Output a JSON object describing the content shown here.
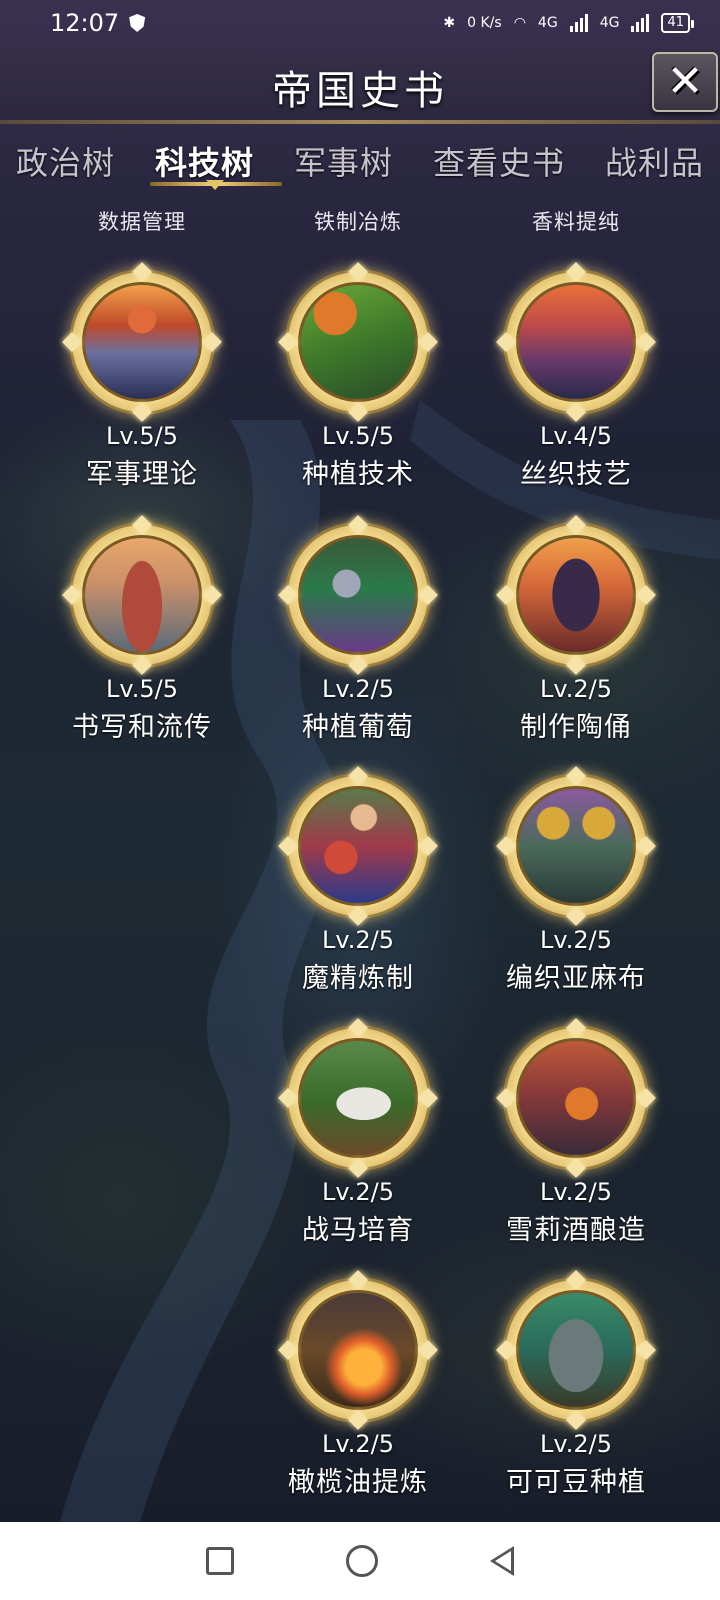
{
  "status_bar": {
    "time": "12:07",
    "net_speed": "0 K/s",
    "signal_1": "4G",
    "signal_2": "4G",
    "battery": "41"
  },
  "header": {
    "title": "帝国史书"
  },
  "tabs": [
    {
      "label": "政治树",
      "active": false
    },
    {
      "label": "科技树",
      "active": true
    },
    {
      "label": "军事树",
      "active": false
    },
    {
      "label": "查看史书",
      "active": false
    },
    {
      "label": "战利品",
      "active": false
    }
  ],
  "columns": [
    {
      "header": "数据管理"
    },
    {
      "header": "铁制冶炼"
    },
    {
      "header": "香料提纯"
    }
  ],
  "nodes": {
    "c0r0": {
      "level": "Lv.5/5",
      "name": "军事理论",
      "icon": "knight-banner-icon"
    },
    "c1r0": {
      "level": "Lv.5/5",
      "name": "种植技术",
      "icon": "farm-field-icon"
    },
    "c2r0": {
      "level": "Lv.4/5",
      "name": "丝织技艺",
      "icon": "silk-workshop-icon"
    },
    "c0r1": {
      "level": "Lv.5/5",
      "name": "书写和流传",
      "icon": "terracotta-warrior-icon"
    },
    "c1r1": {
      "level": "Lv.2/5",
      "name": "种植葡萄",
      "icon": "vineyard-icon"
    },
    "c2r1": {
      "level": "Lv.2/5",
      "name": "制作陶俑",
      "icon": "pottery-figure-icon"
    },
    "c1r2": {
      "level": "Lv.2/5",
      "name": "魔精炼制",
      "icon": "alchemist-icon"
    },
    "c2r2": {
      "level": "Lv.2/5",
      "name": "编织亚麻布",
      "icon": "linen-village-icon"
    },
    "c1r3": {
      "level": "Lv.2/5",
      "name": "战马培育",
      "icon": "warhorse-icon"
    },
    "c2r3": {
      "level": "Lv.2/5",
      "name": "雪莉酒酿造",
      "icon": "wine-brewing-icon"
    },
    "c1r4": {
      "level": "Lv.2/5",
      "name": "橄榄油提炼",
      "icon": "olive-oil-forge-icon"
    },
    "c2r4": {
      "level": "Lv.2/5",
      "name": "可可豆种植",
      "icon": "cocoa-totem-icon"
    }
  },
  "colors": {
    "gold_accent": "#f2d27a",
    "background": "#1f2336"
  }
}
